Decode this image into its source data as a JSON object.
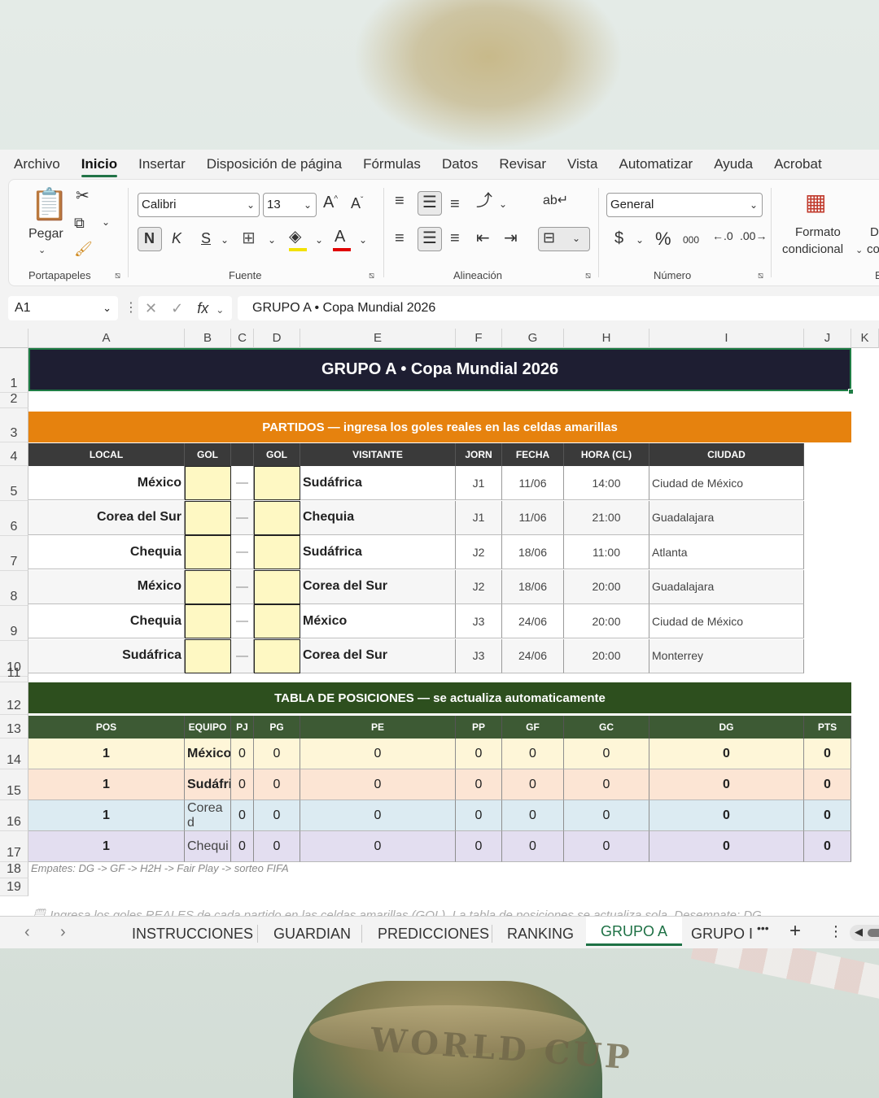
{
  "menu": {
    "tabs": [
      "Archivo",
      "Inicio",
      "Insertar",
      "Disposición de página",
      "Fórmulas",
      "Datos",
      "Revisar",
      "Vista",
      "Automatizar",
      "Ayuda",
      "Acrobat"
    ],
    "active": "Inicio"
  },
  "ribbon": {
    "clipboard": {
      "paste_label": "Pegar",
      "group_label": "Portapapeles"
    },
    "font": {
      "family": "Calibri",
      "size": "13",
      "bold": "N",
      "italic": "K",
      "underline": "S",
      "group_label": "Fuente"
    },
    "alignment": {
      "group_label": "Alineación"
    },
    "number": {
      "format": "General",
      "currency": "$",
      "percent": "%",
      "thousands": "000",
      "group_label": "Número"
    },
    "styles": {
      "cond_format_line1": "Formato",
      "cond_format_line2": "condicional",
      "cut_text": "D",
      "cut_text2": "co",
      "cut_text3": "E"
    }
  },
  "formula_bar": {
    "name_box": "A1",
    "fx": "fx",
    "content": "GRUPO A • Copa Mundial 2026"
  },
  "columns": [
    "A",
    "B",
    "C",
    "D",
    "E",
    "F",
    "G",
    "H",
    "I",
    "J",
    "K"
  ],
  "rows": [
    "1",
    "2",
    "3",
    "4",
    "5",
    "6",
    "7",
    "8",
    "9",
    "10",
    "11",
    "12",
    "13",
    "14",
    "15",
    "16",
    "17",
    "18",
    "19"
  ],
  "sheet": {
    "title": "GRUPO A  •  Copa Mundial 2026",
    "partidos_header": "PARTIDOS — ingresa los goles reales en las celdas amarillas",
    "match_columns": [
      "LOCAL",
      "GOL",
      "",
      "GOL",
      "VISITANTE",
      "JORN",
      "FECHA",
      "HORA (CL)",
      "CIUDAD"
    ],
    "matches": [
      {
        "local": "México",
        "sep": "—",
        "visitante": "Sudáfrica",
        "jorn": "J1",
        "fecha": "11/06",
        "hora": "14:00",
        "ciudad": "Ciudad de México"
      },
      {
        "local": "Corea del Sur",
        "sep": "—",
        "visitante": "Chequia",
        "jorn": "J1",
        "fecha": "11/06",
        "hora": "21:00",
        "ciudad": "Guadalajara"
      },
      {
        "local": "Chequia",
        "sep": "—",
        "visitante": "Sudáfrica",
        "jorn": "J2",
        "fecha": "18/06",
        "hora": "11:00",
        "ciudad": "Atlanta"
      },
      {
        "local": "México",
        "sep": "—",
        "visitante": "Corea del Sur",
        "jorn": "J2",
        "fecha": "18/06",
        "hora": "20:00",
        "ciudad": "Guadalajara"
      },
      {
        "local": "Chequia",
        "sep": "—",
        "visitante": "México",
        "jorn": "J3",
        "fecha": "24/06",
        "hora": "20:00",
        "ciudad": "Ciudad de México"
      },
      {
        "local": "Sudáfrica",
        "sep": "—",
        "visitante": "Corea del Sur",
        "jorn": "J3",
        "fecha": "24/06",
        "hora": "20:00",
        "ciudad": "Monterrey"
      }
    ],
    "standings_header": "TABLA DE POSICIONES — se actualiza automaticamente",
    "standings_columns": [
      "POS",
      "EQUIPO",
      "PJ",
      "PG",
      "PE",
      "PP",
      "GF",
      "GC",
      "DG",
      "PTS"
    ],
    "standings": [
      {
        "pos": "1",
        "equipo": "México",
        "pj": "0",
        "pg": "0",
        "pe": "0",
        "pp": "0",
        "gf": "0",
        "gc": "0",
        "dg": "0",
        "pts": "0",
        "color": "#fef6d8",
        "bold": true
      },
      {
        "pos": "1",
        "equipo": "Sudáfri",
        "pj": "0",
        "pg": "0",
        "pe": "0",
        "pp": "0",
        "gf": "0",
        "gc": "0",
        "dg": "0",
        "pts": "0",
        "color": "#fce5d4",
        "bold": true
      },
      {
        "pos": "1",
        "equipo": "Corea d",
        "pj": "0",
        "pg": "0",
        "pe": "0",
        "pp": "0",
        "gf": "0",
        "gc": "0",
        "dg": "0",
        "pts": "0",
        "color": "#dcebf2",
        "bold": false
      },
      {
        "pos": "1",
        "equipo": "Chequi",
        "pj": "0",
        "pg": "0",
        "pe": "0",
        "pp": "0",
        "gf": "0",
        "gc": "0",
        "dg": "0",
        "pts": "0",
        "color": "#e3def0",
        "bold": false
      }
    ],
    "tiebreak_note": "Empates: DG -> GF -> H2H -> Fair Play -> sorteo FIFA",
    "instructions_note": "🗒 Ingresa los goles REALES de cada partido en las celdas amarillas (GOL). La tabla de posiciones se actualiza sola. Desempate: DG"
  },
  "sheet_tabs": {
    "tabs": [
      "INSTRUCCIONES",
      "GUARDIAN",
      "PREDICCIONES",
      "RANKING",
      "GRUPO A",
      "GRUPO I"
    ],
    "active": "GRUPO A",
    "more": "•••",
    "add": "+",
    "options": "⋮"
  },
  "colors": {
    "excel_green": "#217346",
    "title_bg": "#1e1e32",
    "orange": "#e6820e",
    "dark_green": "#2d4f1e",
    "input_yellow": "#fef8c3"
  }
}
